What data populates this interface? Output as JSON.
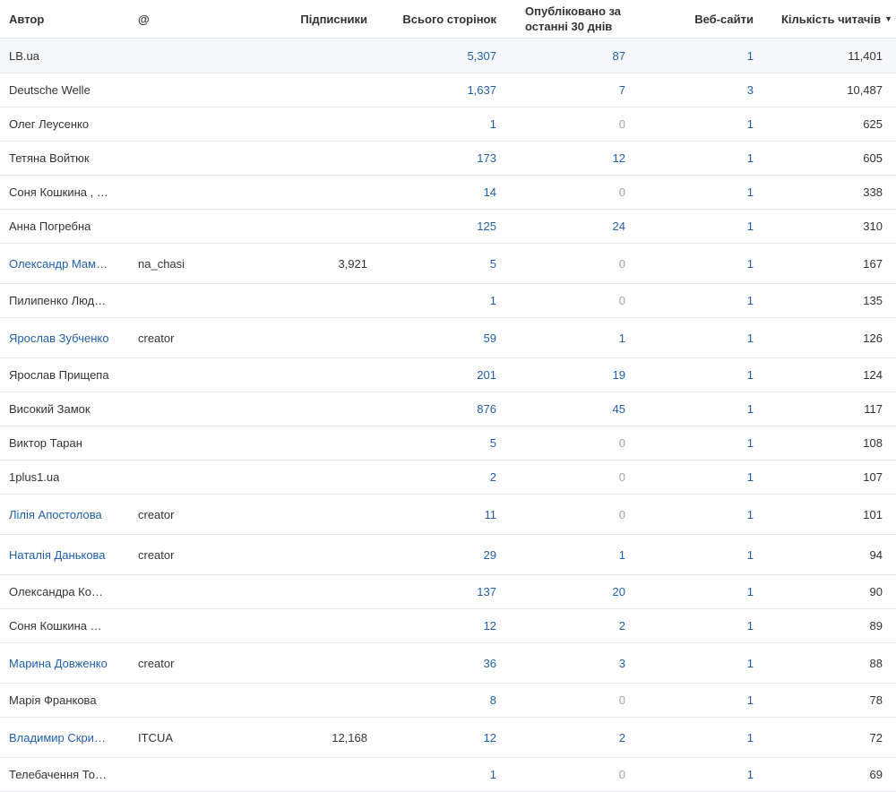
{
  "header": {
    "author": "Автор",
    "at": "@",
    "subscribers": "Підписники",
    "pages_total": "Всього сторінок",
    "published_line1": "Опубліковано за",
    "published_line2": "останні 30 днів",
    "websites": "Веб-сайти",
    "readers": "Кількість читачів",
    "readers_sort_icon": "sort-desc-icon"
  },
  "colors": {
    "link": "#1f5fa8",
    "muted": "#a0a4a8",
    "text": "#333333"
  },
  "rows": [
    {
      "author": "LB.ua",
      "author_link": false,
      "at": "",
      "subscribers": "",
      "pages": "5,307",
      "published": "87",
      "websites": "1",
      "readers": "11,401"
    },
    {
      "author": "Deutsche Welle",
      "author_link": false,
      "at": "",
      "subscribers": "",
      "pages": "1,637",
      "published": "7",
      "websites": "3",
      "readers": "10,487"
    },
    {
      "author": "Олег Леусенко",
      "author_link": false,
      "at": "",
      "subscribers": "",
      "pages": "1",
      "published": "0",
      "websites": "1",
      "readers": "625"
    },
    {
      "author": "Тетяна Войтюк",
      "author_link": false,
      "at": "",
      "subscribers": "",
      "pages": "173",
      "published": "12",
      "websites": "1",
      "readers": "605"
    },
    {
      "author": "Соня Кошкина , …",
      "author_link": false,
      "at": "",
      "subscribers": "",
      "pages": "14",
      "published": "0",
      "websites": "1",
      "readers": "338"
    },
    {
      "author": "Анна Погребна",
      "author_link": false,
      "at": "",
      "subscribers": "",
      "pages": "125",
      "published": "24",
      "websites": "1",
      "readers": "310"
    },
    {
      "author": "Олександр Мам…",
      "author_link": true,
      "at": "na_chasi",
      "subscribers": "3,921",
      "pages": "5",
      "published": "0",
      "websites": "1",
      "readers": "167"
    },
    {
      "author": "Пилипенко Люд…",
      "author_link": false,
      "at": "",
      "subscribers": "",
      "pages": "1",
      "published": "0",
      "websites": "1",
      "readers": "135"
    },
    {
      "author": "Ярослав Зубченко",
      "author_link": true,
      "at": "creator",
      "subscribers": "",
      "pages": "59",
      "published": "1",
      "websites": "1",
      "readers": "126"
    },
    {
      "author": "Ярослав Прищепа",
      "author_link": false,
      "at": "",
      "subscribers": "",
      "pages": "201",
      "published": "19",
      "websites": "1",
      "readers": "124"
    },
    {
      "author": "Високий Замок",
      "author_link": false,
      "at": "",
      "subscribers": "",
      "pages": "876",
      "published": "45",
      "websites": "1",
      "readers": "117"
    },
    {
      "author": "Виктор Таран",
      "author_link": false,
      "at": "",
      "subscribers": "",
      "pages": "5",
      "published": "0",
      "websites": "1",
      "readers": "108"
    },
    {
      "author": "1plus1.ua",
      "author_link": false,
      "at": "",
      "subscribers": "",
      "pages": "2",
      "published": "0",
      "websites": "1",
      "readers": "107"
    },
    {
      "author": "Лілія Апостолова",
      "author_link": true,
      "at": "creator",
      "subscribers": "",
      "pages": "11",
      "published": "0",
      "websites": "1",
      "readers": "101"
    },
    {
      "author": "Наталія Данькова",
      "author_link": true,
      "at": "creator",
      "subscribers": "",
      "pages": "29",
      "published": "1",
      "websites": "1",
      "readers": "94"
    },
    {
      "author": "Олександра Ко…",
      "author_link": false,
      "at": "",
      "subscribers": "",
      "pages": "137",
      "published": "20",
      "websites": "1",
      "readers": "90"
    },
    {
      "author": "Соня Кошкина …",
      "author_link": false,
      "at": "",
      "subscribers": "",
      "pages": "12",
      "published": "2",
      "websites": "1",
      "readers": "89"
    },
    {
      "author": "Марина Довженко",
      "author_link": true,
      "at": "creator",
      "subscribers": "",
      "pages": "36",
      "published": "3",
      "websites": "1",
      "readers": "88"
    },
    {
      "author": "Марія Франкова",
      "author_link": false,
      "at": "",
      "subscribers": "",
      "pages": "8",
      "published": "0",
      "websites": "1",
      "readers": "78"
    },
    {
      "author": "Владимир Скри…",
      "author_link": true,
      "at": "ITCUA",
      "subscribers": "12,168",
      "pages": "12",
      "published": "2",
      "websites": "1",
      "readers": "72"
    },
    {
      "author": "Телебачення То…",
      "author_link": false,
      "at": "",
      "subscribers": "",
      "pages": "1",
      "published": "0",
      "websites": "1",
      "readers": "69"
    }
  ]
}
